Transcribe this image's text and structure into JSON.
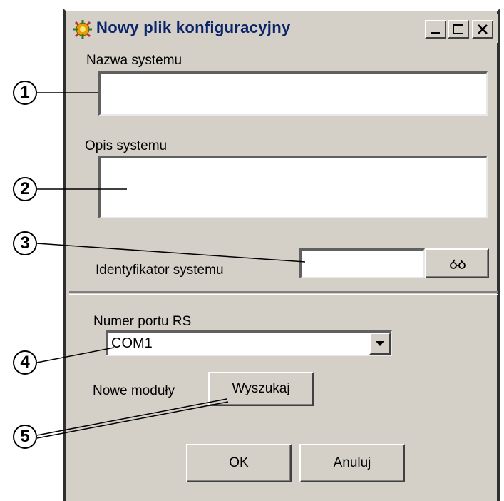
{
  "window": {
    "title": "Nowy plik konfiguracyjny",
    "controls": {
      "minimize": "_",
      "maximize": "□",
      "close": "×"
    }
  },
  "fields": {
    "system_name_label": "Nazwa systemu",
    "system_description_label": "Opis systemu",
    "system_id_label": "Identyfikator systemu"
  },
  "port": {
    "label": "Numer portu RS",
    "selected": "COM1"
  },
  "modules": {
    "label": "Nowe moduły",
    "search_button": "Wyszukaj"
  },
  "buttons": {
    "ok": "OK",
    "cancel": "Anuluj",
    "browse_icon": "binoculars-icon"
  },
  "callouts": [
    "1",
    "2",
    "3",
    "4",
    "5"
  ]
}
